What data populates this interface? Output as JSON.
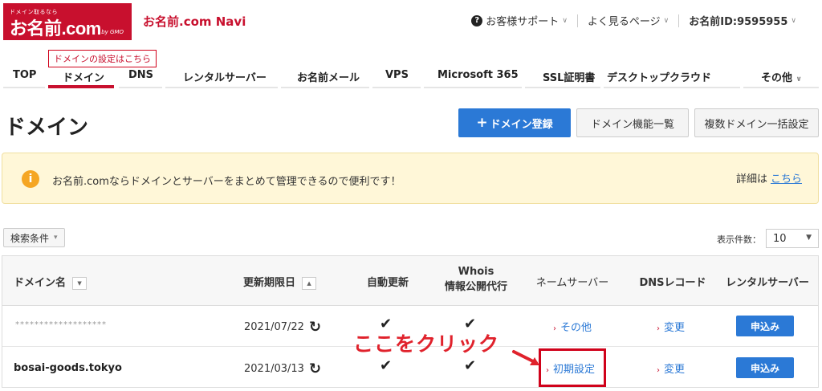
{
  "header": {
    "logo_tag": "ドメイン取るなら",
    "logo_brand": "お名前.com",
    "logo_sub": "by GMO",
    "site_name": "お名前.com Navi",
    "support": "お客様サポート",
    "faq": "よく見るページ",
    "user_id": "お名前ID:9595955"
  },
  "tooltip": "ドメインの設定はこちら",
  "nav": {
    "items": [
      "TOP",
      "ドメイン",
      "DNS",
      "レンタルサーバー",
      "お名前メール",
      "VPS",
      "Microsoft 365",
      "SSL証明書",
      "デスクトップクラウド",
      "その他"
    ],
    "active": "ドメイン"
  },
  "page": {
    "title": "ドメイン",
    "btn_register": "ドメイン登録",
    "btn_features": "ドメイン機能一覧",
    "btn_bulk": "複数ドメイン一括設定"
  },
  "notice": {
    "text": "お名前.comならドメインとサーバーをまとめて管理できるので便利です！",
    "detail_label": "詳細は",
    "detail_link": "こちら"
  },
  "filters": {
    "search_label": "検索条件",
    "per_page_label": "表示件数：",
    "per_page_value": "10"
  },
  "table": {
    "headers": {
      "domain": "ドメイン名",
      "expiry": "更新期限日",
      "auto_renew": "自動更新",
      "whois_1": "Whois",
      "whois_2": "情報公開代行",
      "nameserver": "ネームサーバー",
      "dns": "DNSレコード",
      "server": "レンタルサーバー"
    },
    "rows": [
      {
        "domain": "*******************",
        "expiry": "2021/07/22",
        "nameserver": "その他",
        "dns": "変更",
        "server": "申込み"
      },
      {
        "domain": "bosai-goods.tokyo",
        "expiry": "2021/03/13",
        "nameserver": "初期設定",
        "dns": "変更",
        "server": "申込み"
      }
    ]
  },
  "annotation": {
    "text": "ここをクリック"
  },
  "colors": {
    "brand_red": "#c8102e",
    "primary_blue": "#2b79d6",
    "notice_bg": "#fff7d8",
    "annotation_red": "#e0222c"
  }
}
